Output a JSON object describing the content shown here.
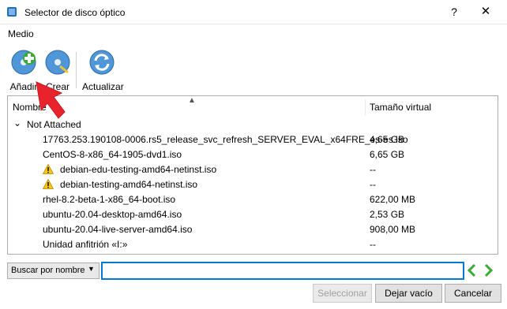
{
  "window": {
    "title": "Selector de disco óptico",
    "help": "?",
    "close": "✕"
  },
  "menu": {
    "label": "Medio"
  },
  "toolbar": {
    "add_label": "Añadir",
    "create_label": "Crear",
    "refresh_label": "Actualizar"
  },
  "list": {
    "col_name": "Nombre",
    "col_size": "Tamaño virtual",
    "group": {
      "expander": "⌄",
      "name": "Not Attached"
    },
    "rows": [
      {
        "name": "17763.253.190108-0006.rs5_release_svc_refresh_SERVER_EVAL_x64FRE_es-es.iso",
        "size": "4,65 GB",
        "warning": false
      },
      {
        "name": "CentOS-8-x86_64-1905-dvd1.iso",
        "size": "6,65 GB",
        "warning": false
      },
      {
        "name": "debian-edu-testing-amd64-netinst.iso",
        "size": "--",
        "warning": true
      },
      {
        "name": "debian-testing-amd64-netinst.iso",
        "size": "--",
        "warning": true
      },
      {
        "name": "rhel-8.2-beta-1-x86_64-boot.iso",
        "size": "622,00 MB",
        "warning": false
      },
      {
        "name": "ubuntu-20.04-desktop-amd64.iso",
        "size": "2,53 GB",
        "warning": false
      },
      {
        "name": "ubuntu-20.04-live-server-amd64.iso",
        "size": "908,00 MB",
        "warning": false
      },
      {
        "name": "Unidad anfitrión «I:»",
        "size": "--",
        "warning": false
      }
    ]
  },
  "search": {
    "mode": "Buscar por nombre",
    "value": ""
  },
  "buttons": {
    "select": "Seleccionar",
    "empty": "Dejar vacío",
    "cancel": "Cancelar"
  },
  "colors": {
    "accent": "#0078d7",
    "pointer": "#e8232b"
  }
}
